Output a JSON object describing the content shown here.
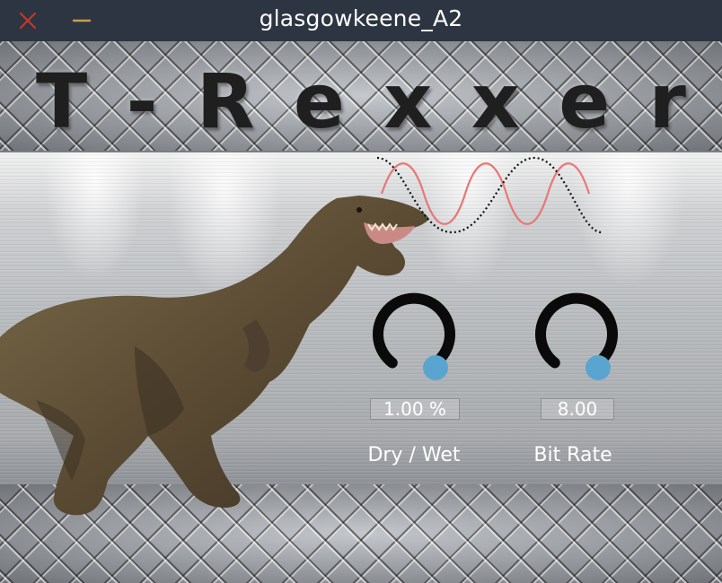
{
  "window": {
    "title": "glasgowkeene_A2",
    "close_icon": "close-icon",
    "minimize_icon": "minimize-icon",
    "colors": {
      "titlebar": "#2c3541",
      "close": "#c0392b",
      "minimize": "#c8a04a"
    }
  },
  "plugin": {
    "logo_text": "T-Rexxer",
    "logo_letters": [
      "T",
      "-",
      "R",
      "e",
      "x",
      "x",
      "e",
      "r"
    ],
    "dinosaur_icon": "t-rex-image",
    "waveform_icon": "sine-waveform-icon",
    "knob_colors": {
      "ring": "#0a0a0a",
      "thumb": "#5aa5d0"
    },
    "knobs": [
      {
        "id": "dry-wet",
        "label": "Dry / Wet",
        "value": "1.00 %"
      },
      {
        "id": "bit-rate",
        "label": "Bit Rate",
        "value": "8.00"
      }
    ]
  }
}
